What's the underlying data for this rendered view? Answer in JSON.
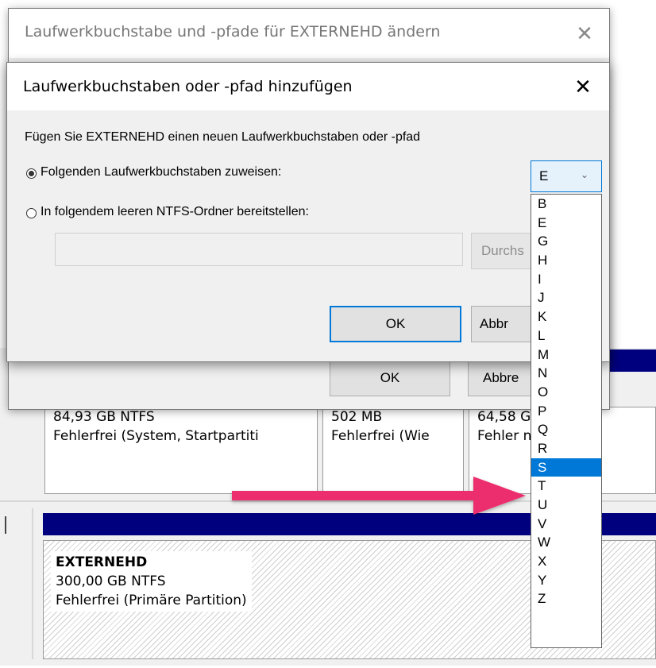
{
  "outer_dialog": {
    "title": "Laufwerkbuchstabe und -pfade für EXTERNEHD ändern",
    "close_glyph": "✕",
    "ok_label": "OK",
    "cancel_label": "Abbre"
  },
  "inner_dialog": {
    "title": "Laufwerkbuchstaben oder -pfad hinzufügen",
    "close_glyph": "✕",
    "description": "Fügen Sie EXTERNEHD einen neuen Laufwerkbuchstaben oder -pfad",
    "option_assign_letter": "Folgenden Laufwerkbuchstaben zuweisen:",
    "option_mount_folder": "In folgendem leeren NTFS-Ordner bereitstellen:",
    "selected_option": "assign_letter",
    "path_value": "",
    "browse_label": "Durchs",
    "ok_label": "OK",
    "cancel_label": "Abbr"
  },
  "drive_select": {
    "value": "E",
    "arrow_icon": "chevron-down-icon",
    "options": [
      "B",
      "E",
      "G",
      "H",
      "I",
      "J",
      "K",
      "L",
      "M",
      "N",
      "O",
      "P",
      "Q",
      "R",
      "S",
      "T",
      "U",
      "V",
      "W",
      "X",
      "Y",
      "Z"
    ],
    "highlighted": "S"
  },
  "disk_partitions": [
    {
      "size": "84,93 GB NTFS",
      "status": "Fehlerfrei (System, Startpartiti"
    },
    {
      "size": "502 MB",
      "status": "Fehlerfrei (Wie"
    },
    {
      "size": "64,58 G",
      "status": "Fehler          näre Pa"
    }
  ],
  "external_disk": {
    "name": "EXTERNEHD",
    "size": "300,00 GB NTFS",
    "status": "Fehlerfrei (Primäre Partition)"
  },
  "colors": {
    "accent": "#0078d7",
    "partition_header": "#00007f",
    "annotation_arrow": "#ec2f6e"
  }
}
